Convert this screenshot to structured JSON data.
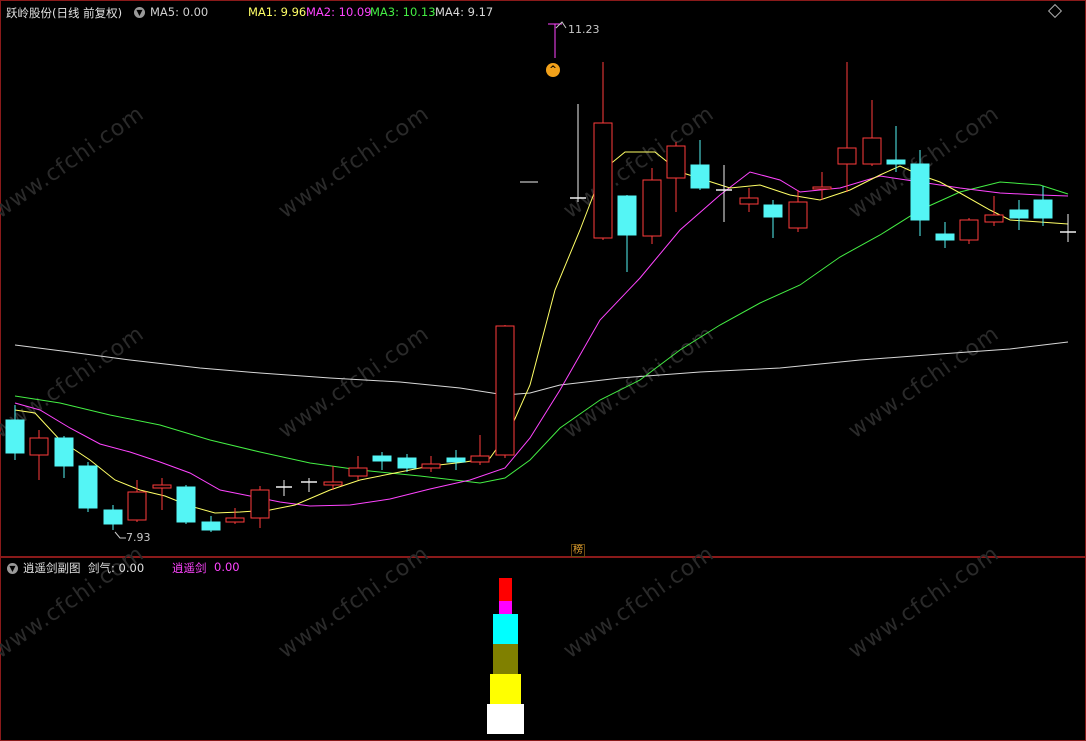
{
  "main_pane": {
    "title": "跃岭股份(日线 前复权)",
    "ma5": "MA5: 0.00",
    "ma1": "MA1: 9.96",
    "ma2": "MA2: 10.09",
    "ma3": "MA3: 10.13",
    "ma4": "MA4: 9.17",
    "high_label": "11.23",
    "low_label": "7.93",
    "badge": "榜",
    "up_marker": "^"
  },
  "sub_pane": {
    "title": "逍遥剑副图",
    "jianqi": "剑气: 0.00",
    "xiaoyao_label": "逍遥剑",
    "xiaoyao_value": "0.00"
  },
  "watermark": "www.cfchi.com",
  "colors": {
    "up": "#ff3b3b",
    "down": "#54f5f5",
    "ma1": "#ffff66",
    "ma2": "#ff44ff",
    "ma3": "#44ee44",
    "ma4": "#d8d8d8",
    "grid": "#8a1a1a"
  }
}
